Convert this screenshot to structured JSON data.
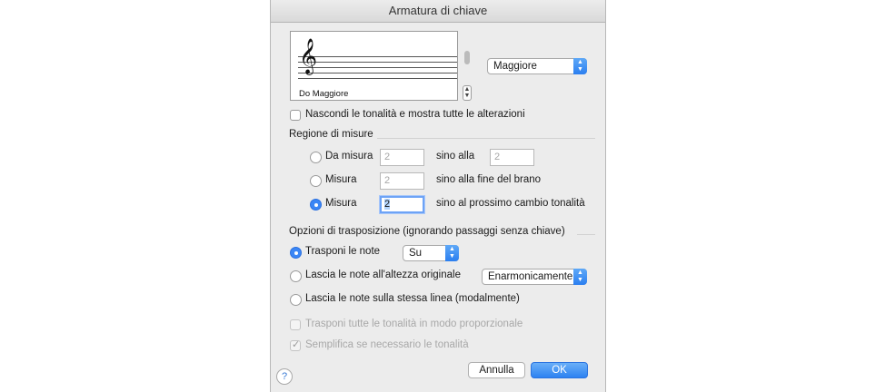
{
  "window": {
    "title": "Armatura di chiave"
  },
  "preview": {
    "key_name": "Do Maggiore",
    "clef_glyph": "𝄞"
  },
  "mode_popup": {
    "value": "Maggiore"
  },
  "hide_keys_checkbox": {
    "label": "Nascondi le tonalità e mostra tutte le alterazioni",
    "checked": false
  },
  "measure_region": {
    "title": "Regione di misure",
    "options": [
      {
        "label": "Da misura",
        "field1": "2",
        "text": "sino alla",
        "field2": "2",
        "selected": false
      },
      {
        "label": "Misura",
        "field1": "2",
        "text": "sino alla fine del brano",
        "selected": false
      },
      {
        "label": "Misura",
        "field1": "2",
        "text": "sino al prossimo cambio tonalità",
        "selected": true
      }
    ]
  },
  "transposition": {
    "title": "Opzioni di trasposizione (ignorando passaggi senza chiave)",
    "options": [
      {
        "label": "Trasponi le note",
        "popup": "Su",
        "selected": true
      },
      {
        "label": "Lascia le note all'altezza originale",
        "popup": "Enarmonicamente",
        "selected": false
      },
      {
        "label": "Lascia le note sulla stessa linea (modalmente)",
        "selected": false
      }
    ],
    "proportional_checkbox": {
      "label": "Trasponi tutte le tonalità in modo proporzionale",
      "checked": false,
      "enabled": false
    },
    "simplify_checkbox": {
      "label": "Semplifica se necessario le tonalità",
      "checked": true,
      "enabled": false
    }
  },
  "buttons": {
    "cancel": "Annulla",
    "ok": "OK",
    "help": "?"
  },
  "colors": {
    "accent": "#3b86f5",
    "dialog_bg": "#ececec"
  },
  "icons": {
    "arrows": "up-down-arrows-icon",
    "check": "✓"
  }
}
